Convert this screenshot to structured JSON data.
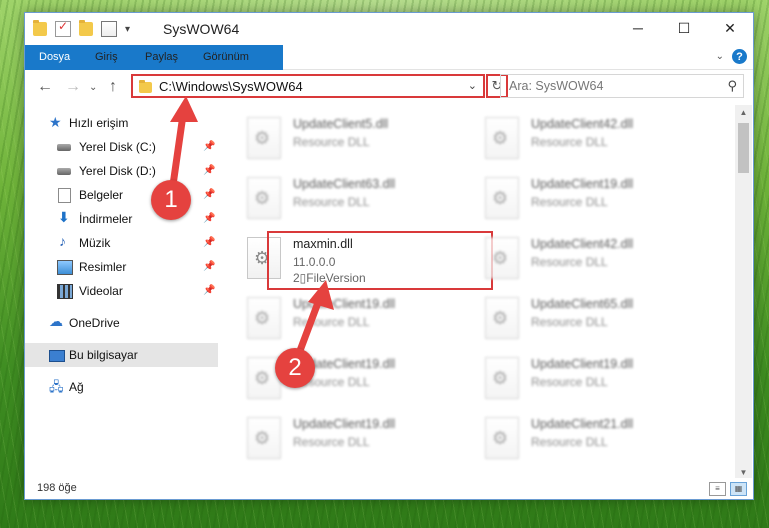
{
  "window": {
    "title": "SysWOW64",
    "controls": {
      "minimize": "─",
      "maximize": "☐",
      "close": "✕"
    }
  },
  "ribbon": {
    "tabs": [
      "Dosya",
      "Giriş",
      "Paylaş",
      "Görünüm"
    ],
    "expand": "⌄",
    "help": "?"
  },
  "nav": {
    "back": "←",
    "forward": "→",
    "history": "⌄",
    "up": "↑"
  },
  "address": {
    "path": "C:\\Windows\\SysWOW64",
    "dropdown": "⌄",
    "refresh": "↻"
  },
  "search": {
    "placeholder": "Ara: SysWOW64",
    "icon": "⚲"
  },
  "sidebar": {
    "items": [
      {
        "label": "Hızlı erişim",
        "icon": "star-icon",
        "glyph": "★"
      },
      {
        "label": "Yerel Disk (C:)",
        "icon": "drive-icon",
        "pinned": true
      },
      {
        "label": "Yerel Disk (D:)",
        "icon": "drive-icon",
        "pinned": true
      },
      {
        "label": "Belgeler",
        "icon": "documents-icon",
        "pinned": true
      },
      {
        "label": "İndirmeler",
        "icon": "download-icon",
        "glyph": "⬇",
        "pinned": true
      },
      {
        "label": "Müzik",
        "icon": "music-icon",
        "glyph": "♪",
        "pinned": true
      },
      {
        "label": "Resimler",
        "icon": "pictures-icon",
        "pinned": true
      },
      {
        "label": "Videolar",
        "icon": "videos-icon",
        "pinned": true
      },
      {
        "label": "OneDrive",
        "icon": "cloud-icon",
        "glyph": "☁"
      },
      {
        "label": "Bu bilgisayar",
        "icon": "computer-icon",
        "selected": true
      },
      {
        "label": "Ağ",
        "icon": "network-icon",
        "glyph": "🖧"
      }
    ],
    "pin_glyph": "📌"
  },
  "files": {
    "left": [
      {
        "name": "UpdateClient5.dll",
        "sub": "Resource DLL"
      },
      {
        "name": "UpdateClient63.dll",
        "sub": "Resource DLL"
      },
      {
        "name": "maxmin.dll",
        "sub": "11.0.0.0",
        "sub2": "2▯FileVersion",
        "highlighted": true
      },
      {
        "name": "UpdateClient19.dll",
        "sub": "Resource DLL"
      },
      {
        "name": "UpdateClient19.dll",
        "sub": "Resource DLL"
      },
      {
        "name": "UpdateClient19.dll",
        "sub": "Resource DLL"
      }
    ],
    "right": [
      {
        "name": "UpdateClient42.dll",
        "sub": "Resource DLL"
      },
      {
        "name": "UpdateClient19.dll",
        "sub": "Resource DLL"
      },
      {
        "name": "UpdateClient42.dll",
        "sub": "Resource DLL"
      },
      {
        "name": "UpdateClient65.dll",
        "sub": "Resource DLL"
      },
      {
        "name": "UpdateClient19.dll",
        "sub": "Resource DLL"
      },
      {
        "name": "UpdateClient21.dll",
        "sub": "Resource DLL"
      }
    ]
  },
  "scroll": {
    "up": "▲",
    "down": "▼"
  },
  "status": {
    "count": "198 öğe",
    "view_details": "≡",
    "view_icons": "▦"
  },
  "annotations": {
    "badge1": "1",
    "badge2": "2",
    "color": "#e5423f"
  }
}
